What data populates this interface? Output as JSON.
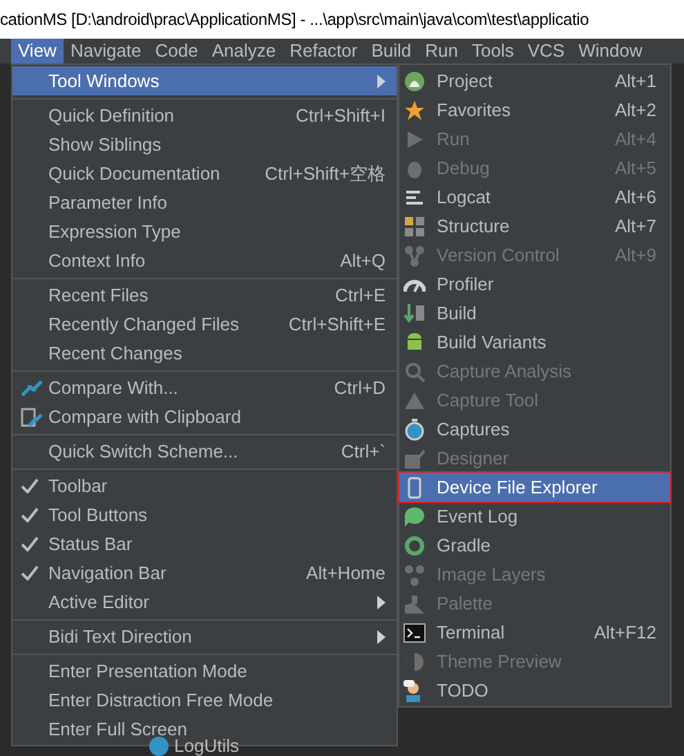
{
  "window": {
    "title": "cationMS [D:\\android\\prac\\ApplicationMS] - ...\\app\\src\\main\\java\\com\\test\\applicatio"
  },
  "menubar": [
    {
      "label": "View",
      "selected": true
    },
    {
      "label": "Navigate",
      "selected": false
    },
    {
      "label": "Code",
      "selected": false
    },
    {
      "label": "Analyze",
      "selected": false
    },
    {
      "label": "Refactor",
      "selected": false
    },
    {
      "label": "Build",
      "selected": false
    },
    {
      "label": "Run",
      "selected": false
    },
    {
      "label": "Tools",
      "selected": false
    },
    {
      "label": "VCS",
      "selected": false
    },
    {
      "label": "Window",
      "selected": false
    }
  ],
  "view_menu": [
    {
      "kind": "item",
      "label": "Tool Windows",
      "selected": true,
      "checked": false,
      "submenu": true
    },
    {
      "kind": "separator"
    },
    {
      "kind": "item",
      "label": "Quick Definition",
      "shortcut": "Ctrl+Shift+I",
      "selected": false,
      "checked": false
    },
    {
      "kind": "item",
      "label": "Show Siblings",
      "selected": false,
      "checked": false
    },
    {
      "kind": "item",
      "label": "Quick Documentation",
      "shortcut": "Ctrl+Shift+空格",
      "selected": false,
      "checked": false
    },
    {
      "kind": "item",
      "label": "Parameter Info",
      "selected": false,
      "checked": false
    },
    {
      "kind": "item",
      "label": "Expression Type",
      "selected": false,
      "checked": false
    },
    {
      "kind": "item",
      "label": "Context Info",
      "shortcut": "Alt+Q",
      "selected": false,
      "checked": false
    },
    {
      "kind": "separator"
    },
    {
      "kind": "item",
      "label": "Recent Files",
      "shortcut": "Ctrl+E",
      "selected": false,
      "checked": false
    },
    {
      "kind": "item",
      "label": "Recently Changed Files",
      "shortcut": "Ctrl+Shift+E",
      "selected": false,
      "checked": false
    },
    {
      "kind": "item",
      "label": "Recent Changes",
      "selected": false,
      "checked": false
    },
    {
      "kind": "separator"
    },
    {
      "kind": "item",
      "label": "Compare With...",
      "shortcut": "Ctrl+D",
      "selected": false,
      "checked": false
    },
    {
      "kind": "item",
      "label": "Compare with Clipboard",
      "selected": false,
      "checked": false
    },
    {
      "kind": "separator"
    },
    {
      "kind": "item",
      "label": "Quick Switch Scheme...",
      "shortcut": "Ctrl+`",
      "selected": false,
      "checked": false
    },
    {
      "kind": "separator"
    },
    {
      "kind": "item",
      "label": "Toolbar",
      "selected": false,
      "checked": true
    },
    {
      "kind": "item",
      "label": "Tool Buttons",
      "selected": false,
      "checked": true
    },
    {
      "kind": "item",
      "label": "Status Bar",
      "selected": false,
      "checked": true
    },
    {
      "kind": "item",
      "label": "Navigation Bar",
      "shortcut": "Alt+Home",
      "selected": false,
      "checked": true
    },
    {
      "kind": "item",
      "label": "Active Editor",
      "selected": false,
      "checked": false,
      "submenu": true
    },
    {
      "kind": "separator"
    },
    {
      "kind": "item",
      "label": "Bidi Text Direction",
      "selected": false,
      "checked": false,
      "submenu": true
    },
    {
      "kind": "separator"
    },
    {
      "kind": "item",
      "label": "Enter Presentation Mode",
      "selected": false,
      "checked": false
    },
    {
      "kind": "item",
      "label": "Enter Distraction Free Mode",
      "selected": false,
      "checked": false
    },
    {
      "kind": "item",
      "label": "Enter Full Screen",
      "selected": false,
      "checked": false
    }
  ],
  "tool_windows_menu": [
    {
      "label": "Project",
      "shortcut": "Alt+1",
      "disabled": false,
      "selected": false
    },
    {
      "label": "Favorites",
      "shortcut": "Alt+2",
      "disabled": false,
      "selected": false
    },
    {
      "label": "Run",
      "shortcut": "Alt+4",
      "disabled": true,
      "selected": false
    },
    {
      "label": "Debug",
      "shortcut": "Alt+5",
      "disabled": true,
      "selected": false
    },
    {
      "label": "Logcat",
      "shortcut": "Alt+6",
      "disabled": false,
      "selected": false
    },
    {
      "label": "Structure",
      "shortcut": "Alt+7",
      "disabled": false,
      "selected": false
    },
    {
      "label": "Version Control",
      "shortcut": "Alt+9",
      "disabled": true,
      "selected": false
    },
    {
      "label": "Profiler",
      "disabled": false,
      "selected": false
    },
    {
      "label": "Build",
      "disabled": false,
      "selected": false
    },
    {
      "label": "Build Variants",
      "disabled": false,
      "selected": false
    },
    {
      "label": "Capture Analysis",
      "disabled": true,
      "selected": false
    },
    {
      "label": "Capture Tool",
      "disabled": true,
      "selected": false
    },
    {
      "label": "Captures",
      "disabled": false,
      "selected": false
    },
    {
      "label": "Designer",
      "disabled": true,
      "selected": false
    },
    {
      "label": "Device File Explorer",
      "disabled": false,
      "selected": true,
      "outlined": true
    },
    {
      "label": "Event Log",
      "disabled": false,
      "selected": false
    },
    {
      "label": "Gradle",
      "disabled": false,
      "selected": false
    },
    {
      "label": "Image Layers",
      "disabled": true,
      "selected": false
    },
    {
      "label": "Palette",
      "disabled": true,
      "selected": false
    },
    {
      "label": "Terminal",
      "shortcut": "Alt+F12",
      "disabled": false,
      "selected": false
    },
    {
      "label": "Theme Preview",
      "disabled": true,
      "selected": false
    },
    {
      "label": "TODO",
      "disabled": false,
      "selected": false
    }
  ],
  "project_tree": {
    "item": "LogUtils"
  }
}
